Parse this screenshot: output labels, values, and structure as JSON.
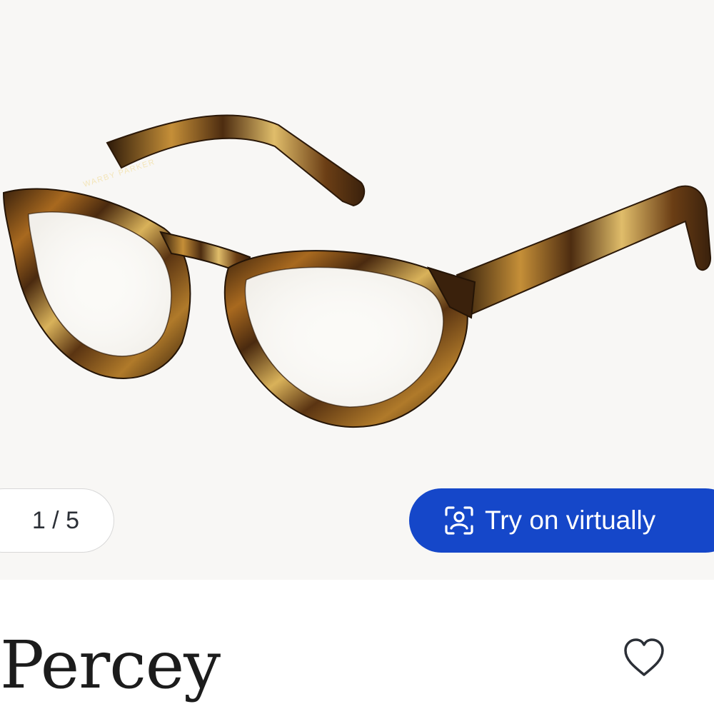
{
  "gallery": {
    "brand_imprint": "WARBY PARKER",
    "counter": "1 / 5",
    "try_on_label": "Try on virtually",
    "try_on_icon": "face-scan-icon"
  },
  "product": {
    "name": "Percey",
    "favorite_icon": "heart-outline-icon"
  },
  "colors": {
    "accent": "#1547c9",
    "gallery_background": "#f8f7f5"
  }
}
